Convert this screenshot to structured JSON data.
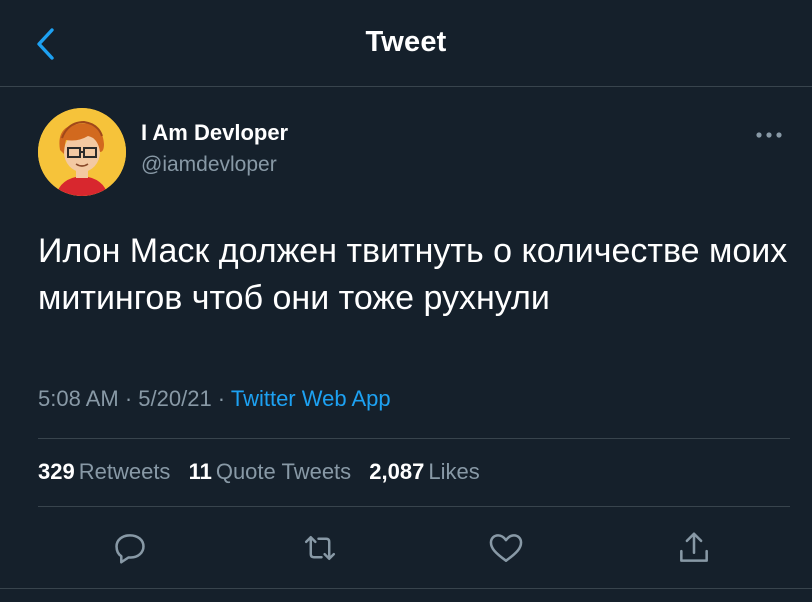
{
  "header": {
    "title": "Tweet",
    "back_icon": "chevron-left-icon",
    "accent_color": "#1da1f2"
  },
  "author": {
    "name": "I Am Devloper",
    "handle": "@iamdevloper",
    "avatar_icon": "cartoon-developer-avatar",
    "more_icon": "more-horizontal-icon"
  },
  "tweet": {
    "text": "Илон Маск должен твитнуть о количестве моих митингов чтоб они тоже рухнули"
  },
  "meta": {
    "time": "5:08 AM",
    "separator": " · ",
    "date": "5/20/21",
    "app": "Twitter Web App"
  },
  "stats": [
    {
      "count": "329",
      "label": "Retweets"
    },
    {
      "count": "11",
      "label": "Quote Tweets"
    },
    {
      "count": "2,087",
      "label": "Likes"
    }
  ],
  "actions": [
    {
      "icon": "reply-icon"
    },
    {
      "icon": "retweet-icon"
    },
    {
      "icon": "like-icon"
    },
    {
      "icon": "share-icon"
    }
  ],
  "colors": {
    "background": "#15202b",
    "secondary_text": "#8899a6",
    "divider": "#38444d",
    "avatar_bg": "#f6c33a"
  }
}
